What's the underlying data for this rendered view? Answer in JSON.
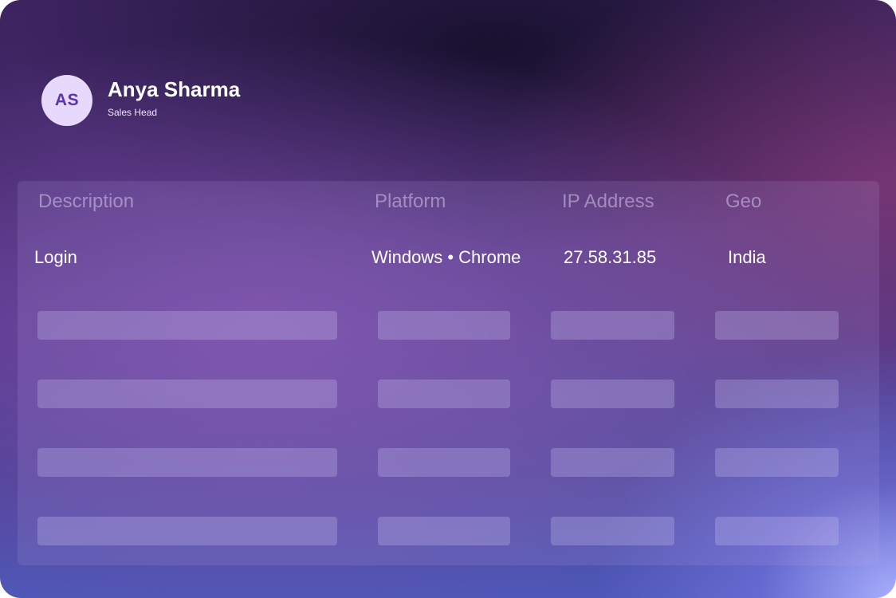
{
  "user": {
    "initials": "AS",
    "name": "Anya Sharma",
    "role": "Sales Head"
  },
  "table": {
    "columns": [
      "Description",
      "Platform",
      "IP Address",
      "Geo"
    ],
    "rows": [
      {
        "description": "Login",
        "platform": "Windows • Chrome",
        "ip_address": "27.58.31.85",
        "geo": "India"
      }
    ],
    "placeholder_row_count": 4
  },
  "colors": {
    "avatar_bg": "#e6d9fb",
    "avatar_text": "#5a33b0"
  }
}
